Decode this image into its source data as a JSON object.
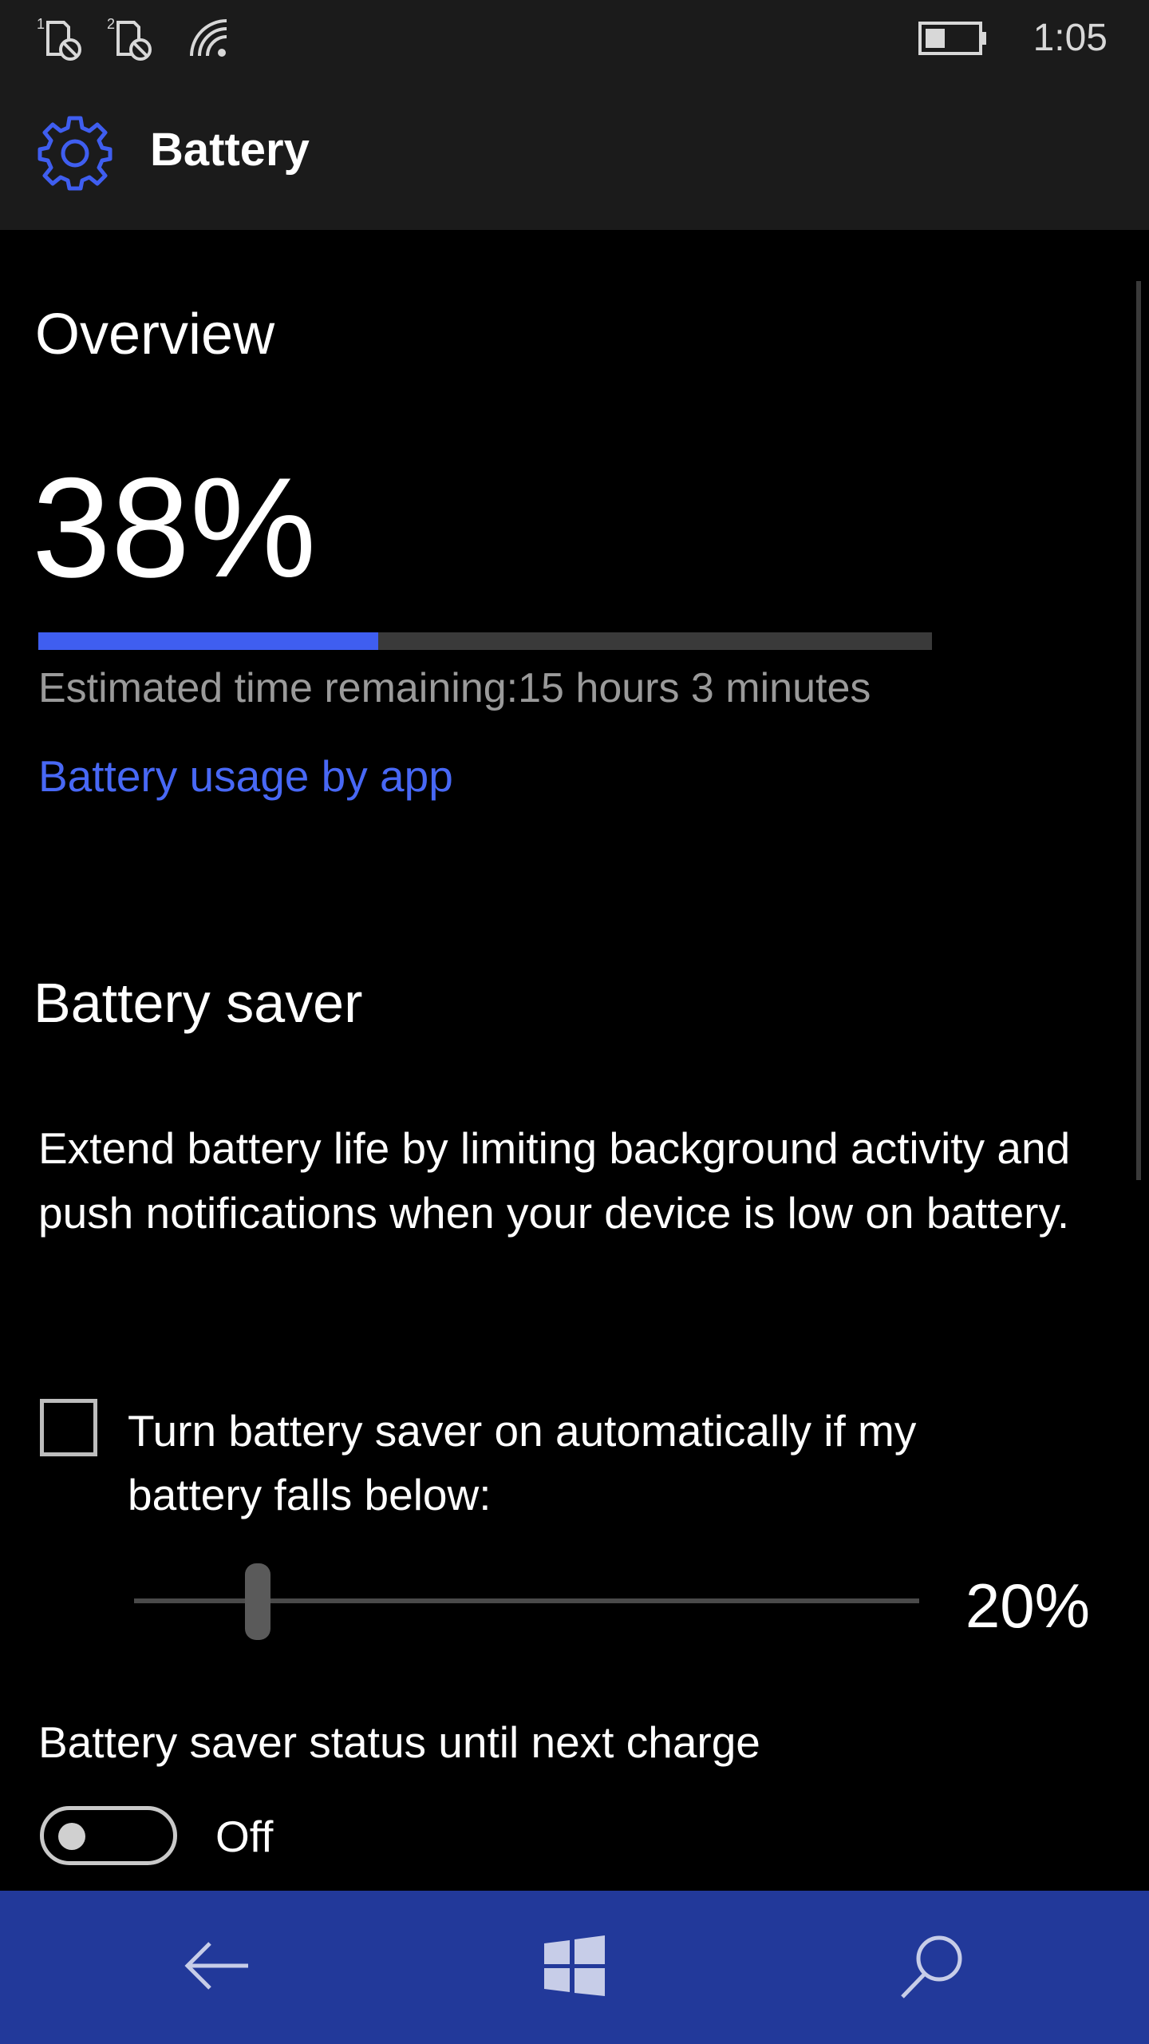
{
  "status_bar": {
    "time": "1:05",
    "sim1_label": "1",
    "sim2_label": "2",
    "icons": [
      "sim1-no-signal-icon",
      "sim2-no-signal-icon",
      "wifi-icon",
      "battery-icon"
    ],
    "battery_level_fraction": 0.38
  },
  "header": {
    "title": "Battery",
    "icon": "gear-icon",
    "accent_color": "#3f5ef0"
  },
  "overview": {
    "heading": "Overview",
    "percent_text": "38%",
    "charge_fraction": 0.38,
    "estimated_time": "Estimated time remaining:15 hours 3 minutes",
    "usage_link": "Battery usage by app"
  },
  "battery_saver": {
    "heading": "Battery saver",
    "description": "Extend battery life by limiting background activity and push notifications when your device is low on battery.",
    "auto_checkbox": {
      "checked": false,
      "label": "Turn battery saver on automatically if my battery falls below:"
    },
    "threshold": {
      "value_text": "20%",
      "value": 20,
      "min": 5,
      "max": 100
    },
    "status_label": "Battery saver status until next charge",
    "toggle": {
      "on": false,
      "state_text": "Off"
    }
  },
  "nav_bar": {
    "back_icon": "back-arrow-icon",
    "home_icon": "windows-logo-icon",
    "search_icon": "search-icon",
    "background_color": "#22399a"
  }
}
